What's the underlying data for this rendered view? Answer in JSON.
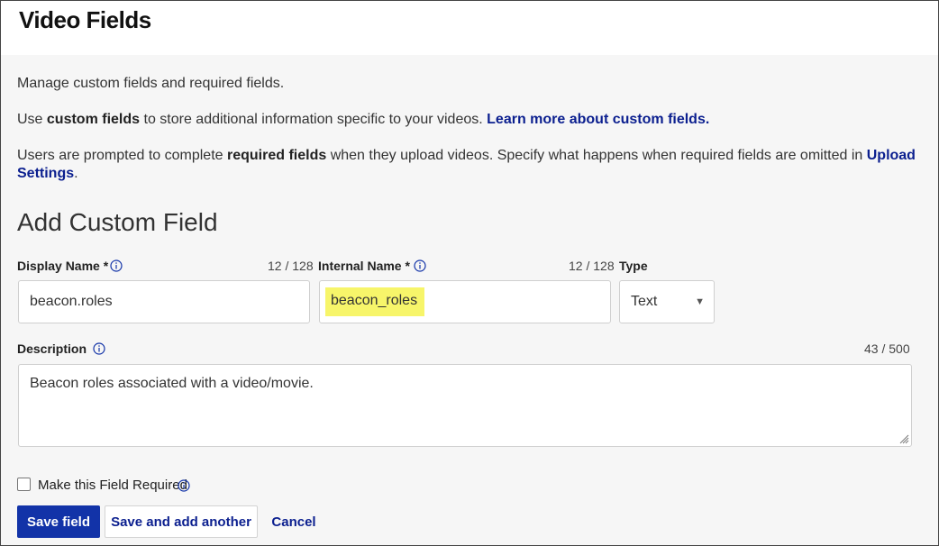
{
  "header": {
    "title": "Video Fields"
  },
  "intro": {
    "line1": "Manage custom fields and required fields.",
    "line2_pre": "Use ",
    "line2_bold": "custom fields",
    "line2_mid": " to store additional information specific to your videos. ",
    "line2_link": "Learn more about custom fields.",
    "line3_pre": "Users are prompted to complete ",
    "line3_bold": "required fields",
    "line3_mid": " when they upload videos. Specify what happens when required fields are omitted in ",
    "line3_link": "Upload Settings",
    "line3_end": "."
  },
  "form": {
    "section_title": "Add Custom Field",
    "display_name": {
      "label": "Display Name *",
      "counter": "12 / 128",
      "value": "beacon.roles",
      "info_icon": "info-circle-icon"
    },
    "internal_name": {
      "label": "Internal Name *",
      "counter": "12 / 128",
      "value": "beacon_roles",
      "info_icon": "info-circle-icon"
    },
    "type": {
      "label": "Type",
      "value": "Text",
      "arrow_icon": "caret-down-icon"
    },
    "description": {
      "label": "Description",
      "counter": "43 / 500",
      "value": "Beacon roles associated with a video/movie.",
      "info_icon": "info-circle-icon"
    },
    "required": {
      "label": "Make this Field Required",
      "checked": false,
      "info_icon": "info-circle-icon"
    }
  },
  "actions": {
    "save": "Save field",
    "save_add": "Save and add another",
    "cancel": "Cancel"
  },
  "colors": {
    "primary": "#1233a8",
    "link": "#0b1f8f",
    "highlight": "#f7f56a"
  }
}
